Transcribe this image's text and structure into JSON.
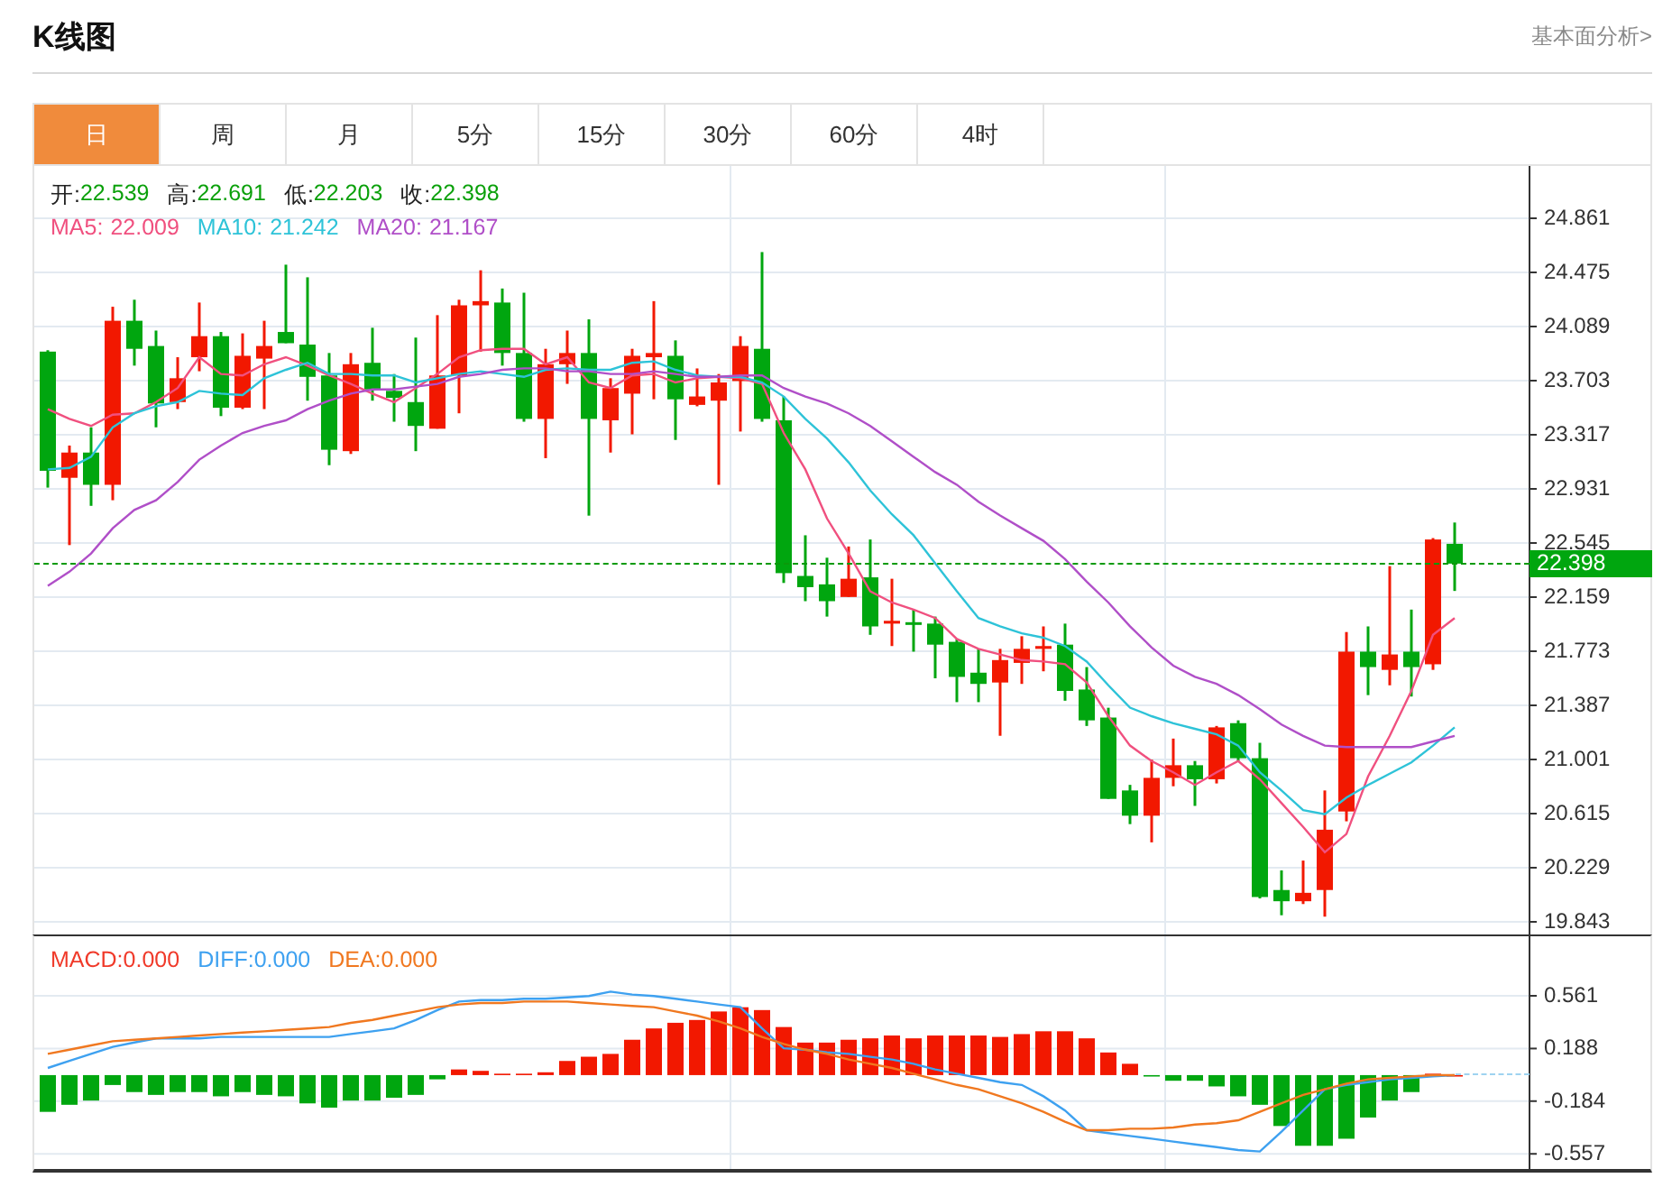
{
  "title": "K线图",
  "link": "基本面分析>",
  "tabs": [
    {
      "label": "日",
      "selected": true
    },
    {
      "label": "周",
      "selected": false
    },
    {
      "label": "月",
      "selected": false
    },
    {
      "label": "5分",
      "selected": false
    },
    {
      "label": "15分",
      "selected": false
    },
    {
      "label": "30分",
      "selected": false
    },
    {
      "label": "60分",
      "selected": false
    },
    {
      "label": "4时",
      "selected": false
    }
  ],
  "price_chart": {
    "quote": [
      {
        "label": "开:",
        "value": "22.539"
      },
      {
        "label": "高:",
        "value": "22.691"
      },
      {
        "label": "低:",
        "value": "22.203"
      },
      {
        "label": "收:",
        "value": "22.398"
      }
    ],
    "last_price": "22.398",
    "ma_legend": [
      {
        "label": "MA5:",
        "value": "22.009",
        "color": "#f0507f"
      },
      {
        "label": "MA10:",
        "value": "21.242",
        "color": "#2ec3d8"
      },
      {
        "label": "MA20:",
        "value": "21.167",
        "color": "#b04fc8"
      }
    ],
    "chart_data": {
      "type": "candlestick",
      "grid": true,
      "ylim": [
        19.753,
        25.234
      ],
      "yticks": [
        24.861,
        24.475,
        24.089,
        23.703,
        23.317,
        22.931,
        22.545,
        22.159,
        21.773,
        21.387,
        21.001,
        20.615,
        20.229,
        19.843
      ],
      "series": [
        {
          "type": "line",
          "color": "#f0507f",
          "values": [
            23.5,
            23.43,
            23.38,
            23.46,
            23.47,
            23.55,
            23.65,
            23.87,
            23.75,
            23.74,
            23.82,
            23.87,
            23.81,
            23.74,
            23.68,
            23.61,
            23.55,
            23.65,
            23.75,
            23.87,
            23.92,
            23.93,
            23.93,
            23.82,
            23.87,
            23.69,
            23.65,
            23.74,
            23.75,
            23.69,
            23.72,
            23.73,
            23.72,
            23.68,
            23.33,
            23.07,
            22.72,
            22.47,
            22.2,
            22.12,
            22.07,
            22.01,
            21.86,
            21.79,
            21.75,
            21.71,
            21.7,
            21.68,
            21.55,
            21.31,
            21.1,
            20.99,
            20.91,
            20.82,
            20.91,
            20.99,
            20.86,
            20.69,
            20.52,
            20.34,
            20.47,
            20.88,
            21.17,
            21.49,
            21.89,
            22.01
          ]
        },
        {
          "type": "line",
          "color": "#2ec3d8",
          "values": [
            23.07,
            23.08,
            23.16,
            23.37,
            23.47,
            23.52,
            23.55,
            23.63,
            23.61,
            23.6,
            23.72,
            23.78,
            23.83,
            23.75,
            23.75,
            23.74,
            23.74,
            23.69,
            23.72,
            23.75,
            23.77,
            23.75,
            23.73,
            23.78,
            23.79,
            23.78,
            23.78,
            23.83,
            23.84,
            23.78,
            23.74,
            23.73,
            23.73,
            23.69,
            23.59,
            23.43,
            23.29,
            23.12,
            22.92,
            22.75,
            22.6,
            22.4,
            22.2,
            22.01,
            21.95,
            21.9,
            21.87,
            21.81,
            21.7,
            21.53,
            21.37,
            21.31,
            21.26,
            21.22,
            21.18,
            21.1,
            20.91,
            20.78,
            20.64,
            20.61,
            20.73,
            20.82,
            20.9,
            20.98,
            21.1,
            21.23
          ]
        },
        {
          "type": "line",
          "color": "#b04fc8",
          "values": [
            22.24,
            22.34,
            22.47,
            22.65,
            22.78,
            22.85,
            22.98,
            23.14,
            23.24,
            23.33,
            23.38,
            23.42,
            23.5,
            23.56,
            23.61,
            23.64,
            23.64,
            23.66,
            23.68,
            23.73,
            23.75,
            23.78,
            23.79,
            23.79,
            23.77,
            23.77,
            23.75,
            23.75,
            23.77,
            23.75,
            23.73,
            23.73,
            23.74,
            23.74,
            23.65,
            23.59,
            23.54,
            23.47,
            23.38,
            23.27,
            23.16,
            23.05,
            22.96,
            22.84,
            22.74,
            22.65,
            22.56,
            22.43,
            22.27,
            22.12,
            21.95,
            21.8,
            21.67,
            21.59,
            21.54,
            21.46,
            21.36,
            21.25,
            21.17,
            21.1,
            21.09,
            21.09,
            21.09,
            21.09,
            21.13,
            21.17
          ]
        }
      ],
      "ohlc": [
        [
          23.91,
          23.92,
          22.94,
          23.06
        ],
        [
          23.01,
          23.24,
          22.53,
          23.19
        ],
        [
          23.19,
          23.37,
          22.81,
          22.96
        ],
        [
          22.96,
          24.23,
          22.85,
          24.13
        ],
        [
          24.13,
          24.28,
          23.81,
          23.93
        ],
        [
          23.95,
          24.06,
          23.37,
          23.54
        ],
        [
          23.55,
          23.87,
          23.5,
          23.72
        ],
        [
          23.87,
          24.26,
          23.77,
          24.02
        ],
        [
          24.02,
          24.05,
          23.45,
          23.51
        ],
        [
          23.51,
          24.04,
          23.5,
          23.88
        ],
        [
          23.86,
          24.13,
          23.5,
          23.95
        ],
        [
          24.05,
          24.53,
          23.97,
          23.97
        ],
        [
          23.96,
          24.44,
          23.56,
          23.73
        ],
        [
          23.74,
          23.9,
          23.1,
          23.21
        ],
        [
          23.2,
          23.9,
          23.18,
          23.82
        ],
        [
          23.83,
          24.08,
          23.56,
          23.64
        ],
        [
          23.63,
          23.75,
          23.41,
          23.58
        ],
        [
          23.55,
          24.01,
          23.2,
          23.38
        ],
        [
          23.36,
          24.17,
          23.36,
          23.74
        ],
        [
          23.74,
          24.28,
          23.47,
          24.24
        ],
        [
          24.24,
          24.49,
          23.91,
          24.27
        ],
        [
          24.26,
          24.36,
          23.81,
          23.9
        ],
        [
          23.9,
          24.33,
          23.41,
          23.43
        ],
        [
          23.43,
          23.93,
          23.15,
          23.82
        ],
        [
          23.82,
          24.06,
          23.68,
          23.9
        ],
        [
          23.9,
          24.14,
          22.74,
          23.43
        ],
        [
          23.42,
          23.72,
          23.19,
          23.65
        ],
        [
          23.61,
          23.93,
          23.32,
          23.88
        ],
        [
          23.87,
          24.27,
          23.57,
          23.9
        ],
        [
          23.88,
          23.99,
          23.28,
          23.57
        ],
        [
          23.53,
          23.79,
          23.52,
          23.59
        ],
        [
          23.56,
          23.75,
          22.96,
          23.69
        ],
        [
          23.7,
          24.02,
          23.34,
          23.95
        ],
        [
          23.93,
          24.62,
          23.41,
          23.43
        ],
        [
          23.42,
          23.59,
          22.26,
          22.33
        ],
        [
          22.31,
          22.6,
          22.13,
          22.23
        ],
        [
          22.25,
          22.44,
          22.02,
          22.13
        ],
        [
          22.16,
          22.52,
          22.16,
          22.29
        ],
        [
          22.3,
          22.57,
          21.89,
          21.95
        ],
        [
          21.97,
          22.29,
          21.81,
          21.99
        ],
        [
          21.98,
          22.07,
          21.77,
          21.97
        ],
        [
          21.97,
          22.02,
          21.58,
          21.82
        ],
        [
          21.84,
          21.86,
          21.41,
          21.59
        ],
        [
          21.62,
          21.79,
          21.41,
          21.54
        ],
        [
          21.55,
          21.79,
          21.17,
          21.71
        ],
        [
          21.69,
          21.88,
          21.54,
          21.79
        ],
        [
          21.79,
          21.95,
          21.63,
          21.81
        ],
        [
          21.82,
          21.97,
          21.42,
          21.49
        ],
        [
          21.5,
          21.66,
          21.24,
          21.28
        ],
        [
          21.3,
          21.37,
          20.72,
          20.72
        ],
        [
          20.78,
          20.82,
          20.54,
          20.6
        ],
        [
          20.6,
          21.0,
          20.41,
          20.87
        ],
        [
          20.87,
          21.15,
          20.81,
          20.96
        ],
        [
          20.96,
          20.99,
          20.67,
          20.86
        ],
        [
          20.86,
          21.24,
          20.83,
          21.23
        ],
        [
          21.26,
          21.28,
          20.99,
          21.01
        ],
        [
          21.01,
          21.12,
          20.01,
          20.02
        ],
        [
          20.07,
          20.21,
          19.89,
          19.99
        ],
        [
          19.99,
          20.28,
          19.97,
          20.05
        ],
        [
          20.07,
          20.78,
          19.88,
          20.5
        ],
        [
          20.63,
          21.91,
          20.56,
          21.77
        ],
        [
          21.77,
          21.95,
          21.46,
          21.66
        ],
        [
          21.64,
          22.38,
          21.53,
          21.75
        ],
        [
          21.77,
          22.07,
          21.45,
          21.66
        ],
        [
          21.68,
          22.58,
          21.64,
          22.57
        ],
        [
          22.539,
          22.691,
          22.203,
          22.398
        ]
      ]
    }
  },
  "macd_chart": {
    "legend": [
      {
        "label": "MACD:",
        "value": "0.000",
        "color": "#f03a2a"
      },
      {
        "label": "DIFF:",
        "value": "0.000",
        "color": "#3ea1f0"
      },
      {
        "label": "DEA:",
        "value": "0.000",
        "color": "#f07820"
      }
    ],
    "chart_data": {
      "type": "bar",
      "grid": true,
      "ylim": [
        -0.664,
        0.982
      ],
      "yticks": [
        0.561,
        0.188,
        -0.184,
        -0.557
      ],
      "colors": [
        "#00a60f",
        "#00a60f",
        "#00a60f",
        "#00a60f",
        "#00a60f",
        "#00a60f",
        "#00a60f",
        "#00a60f",
        "#00a60f",
        "#00a60f",
        "#00a60f",
        "#00a60f",
        "#00a60f",
        "#00a60f",
        "#00a60f",
        "#00a60f",
        "#00a60f",
        "#00a60f",
        "#00a60f",
        "#f21800",
        "#f21800",
        "#f21800",
        "#f21800",
        "#f21800",
        "#f21800",
        "#f21800",
        "#f21800",
        "#f21800",
        "#f21800",
        "#f21800",
        "#f21800",
        "#f21800",
        "#f21800",
        "#f21800",
        "#f21800",
        "#f21800",
        "#f21800",
        "#f21800",
        "#f21800",
        "#f21800",
        "#f21800",
        "#f21800",
        "#f21800",
        "#f21800",
        "#f21800",
        "#f21800",
        "#f21800",
        "#f21800",
        "#f21800",
        "#f21800",
        "#f21800",
        "#00a60f",
        "#00a60f",
        "#00a60f",
        "#00a60f",
        "#00a60f",
        "#00a60f",
        "#00a60f",
        "#00a60f",
        "#00a60f",
        "#00a60f",
        "#00a60f",
        "#00a60f",
        "#00a60f",
        "#f21800",
        "#f21800"
      ],
      "values": [
        -0.26,
        -0.21,
        -0.18,
        -0.07,
        -0.12,
        -0.14,
        -0.12,
        -0.12,
        -0.15,
        -0.12,
        -0.14,
        -0.15,
        -0.2,
        -0.23,
        -0.18,
        -0.18,
        -0.16,
        -0.14,
        -0.03,
        0.04,
        0.03,
        0.01,
        0.01,
        0.02,
        0.1,
        0.13,
        0.15,
        0.25,
        0.33,
        0.37,
        0.39,
        0.45,
        0.48,
        0.46,
        0.34,
        0.23,
        0.23,
        0.25,
        0.26,
        0.28,
        0.26,
        0.28,
        0.28,
        0.28,
        0.27,
        0.29,
        0.31,
        0.31,
        0.26,
        0.16,
        0.08,
        -0.01,
        -0.04,
        -0.04,
        -0.08,
        -0.15,
        -0.21,
        -0.36,
        -0.5,
        -0.5,
        -0.45,
        -0.3,
        -0.18,
        -0.12,
        0.01,
        0.0
      ],
      "series": [
        {
          "type": "line",
          "color": "#3ea1f0",
          "values": [
            0.05,
            0.1,
            0.15,
            0.2,
            0.23,
            0.26,
            0.26,
            0.26,
            0.27,
            0.27,
            0.27,
            0.27,
            0.27,
            0.27,
            0.29,
            0.31,
            0.33,
            0.39,
            0.46,
            0.52,
            0.53,
            0.53,
            0.54,
            0.54,
            0.55,
            0.56,
            0.59,
            0.57,
            0.56,
            0.54,
            0.52,
            0.5,
            0.48,
            0.33,
            0.19,
            0.18,
            0.16,
            0.15,
            0.13,
            0.11,
            0.08,
            0.04,
            0.01,
            -0.02,
            -0.05,
            -0.07,
            -0.15,
            -0.25,
            -0.39,
            -0.41,
            -0.43,
            -0.45,
            -0.47,
            -0.49,
            -0.51,
            -0.53,
            -0.54,
            -0.4,
            -0.25,
            -0.1,
            -0.07,
            -0.05,
            -0.03,
            -0.02,
            -0.01,
            0.0
          ]
        },
        {
          "type": "line",
          "color": "#f07820",
          "values": [
            0.15,
            0.18,
            0.21,
            0.24,
            0.25,
            0.26,
            0.27,
            0.28,
            0.29,
            0.3,
            0.31,
            0.32,
            0.33,
            0.34,
            0.37,
            0.39,
            0.42,
            0.45,
            0.48,
            0.5,
            0.51,
            0.51,
            0.52,
            0.52,
            0.52,
            0.51,
            0.5,
            0.49,
            0.48,
            0.45,
            0.42,
            0.38,
            0.33,
            0.27,
            0.22,
            0.18,
            0.15,
            0.11,
            0.08,
            0.05,
            0.01,
            -0.03,
            -0.07,
            -0.1,
            -0.15,
            -0.2,
            -0.26,
            -0.33,
            -0.39,
            -0.39,
            -0.38,
            -0.38,
            -0.37,
            -0.35,
            -0.34,
            -0.32,
            -0.26,
            -0.2,
            -0.14,
            -0.1,
            -0.06,
            -0.03,
            -0.02,
            -0.01,
            0.0,
            0.0
          ]
        }
      ]
    }
  }
}
